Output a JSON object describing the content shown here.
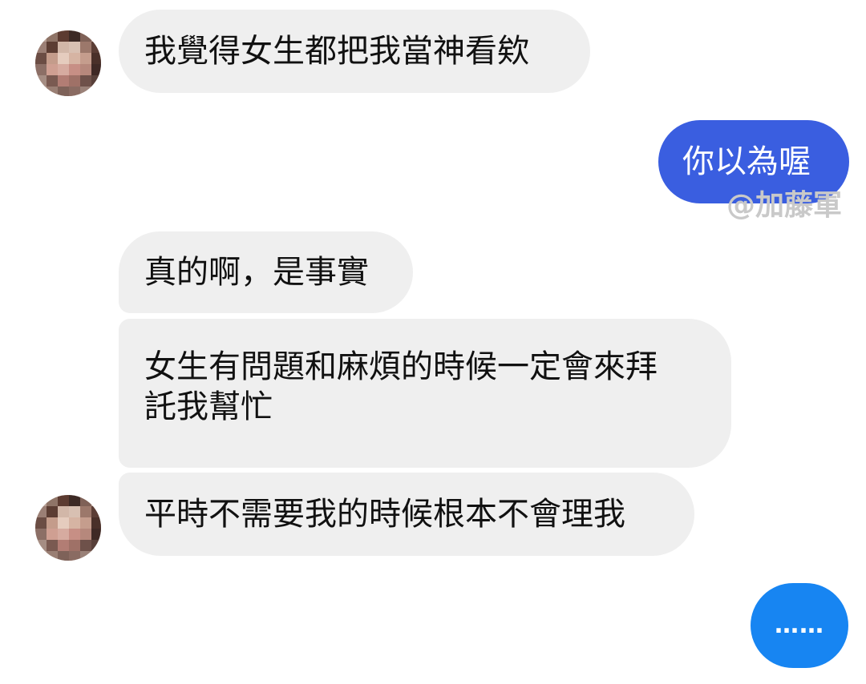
{
  "messages": [
    {
      "text": "我覺得女生都把我當神看欸"
    },
    {
      "text": "你以為喔"
    },
    {
      "text": "真的啊，是事實"
    },
    {
      "text": "女生有問題和麻煩的時候一定會來拜\n託我幫忙"
    },
    {
      "text": "平時不需要我的時候根本不會理我"
    },
    {
      "text": "……"
    }
  ],
  "watermark": "@加藤軍",
  "colors": {
    "incoming_bubble": "#efefef",
    "outgoing_bubble": "#3a5ee0",
    "typing_bubble": "#1785f2",
    "background": "#ffffff"
  },
  "icons": {
    "avatar": "blurred-avatar-icon"
  }
}
